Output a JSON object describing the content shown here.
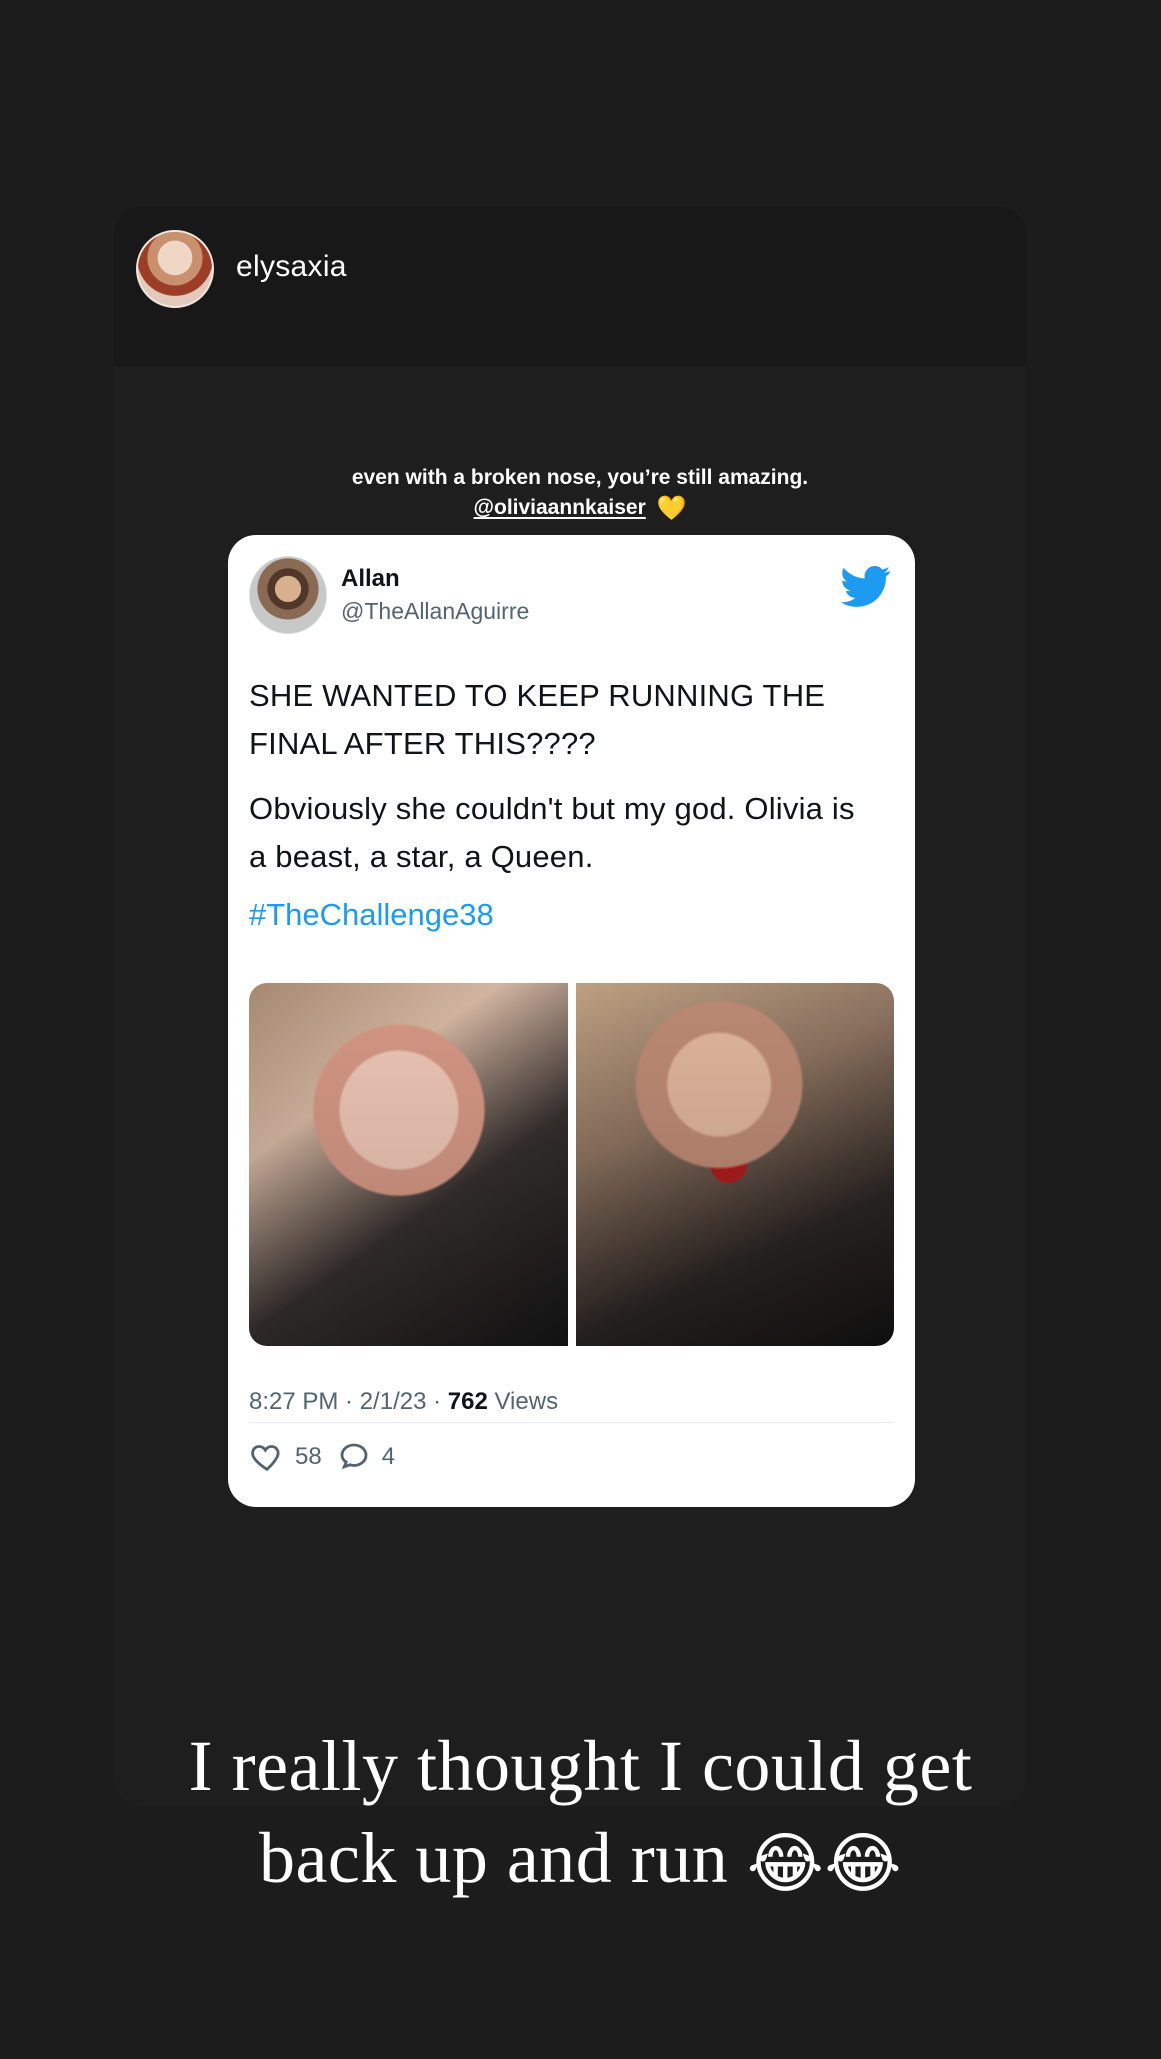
{
  "story": {
    "username": "elysaxia",
    "caption_line_1": "even with a broken nose, you’re still amazing.",
    "caption_mention": "@oliviaannkaiser",
    "caption_emoji": "💛",
    "overlay_text_line_1": "I really thought I could get",
    "overlay_text_line_2": "back up and run",
    "overlay_emoji": "😂😂"
  },
  "tweet": {
    "name": "Allan",
    "handle": "@TheAllanAguirre",
    "text_line_1": "SHE WANTED TO KEEP RUNNING THE FINAL AFTER THIS????",
    "text_line_2": "Obviously she couldn't but my god. Olivia is a beast, a star, a Queen.",
    "hashtag": "#TheChallenge38",
    "timestamp": "8:27 PM · 2/1/23 · ",
    "views_count": "762",
    "views_label": " Views",
    "likes": "58",
    "replies": "4"
  },
  "colors": {
    "background": "#1c1c1c",
    "tweet_background": "#ffffff",
    "twitter_blue": "#1d9bf0",
    "muted_text": "#536471"
  },
  "icons": {
    "brand": "twitter-bird-icon",
    "like": "heart-outline-icon",
    "reply": "speech-bubble-icon"
  }
}
